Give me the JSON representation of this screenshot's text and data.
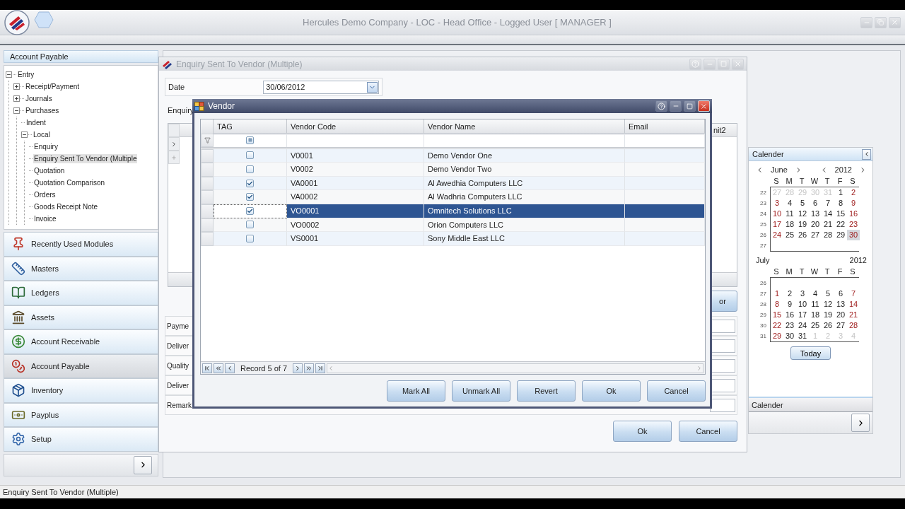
{
  "app": {
    "title": "Hercules  Demo Company - LOC - Head Office - Logged User [ MANAGER ]"
  },
  "sidebar": {
    "header": "Account Payable",
    "tree": [
      {
        "label": "Entry",
        "expanded": true,
        "selected": false,
        "children": [
          {
            "label": "Receipt/Payment",
            "expanded": false,
            "selected": false
          },
          {
            "label": "Journals",
            "expanded": false,
            "selected": false
          },
          {
            "label": "Purchases",
            "expanded": true,
            "selected": false,
            "children": [
              {
                "label": "Indent",
                "selected": false
              },
              {
                "label": "Local",
                "expanded": true,
                "selected": false,
                "children": [
                  {
                    "label": "Enquiry",
                    "selected": false
                  },
                  {
                    "label": "Enquiry Sent To Vendor (Multiple",
                    "selected": true
                  },
                  {
                    "label": "Quotation",
                    "selected": false
                  },
                  {
                    "label": "Quotation Comparison",
                    "selected": false
                  },
                  {
                    "label": "Orders",
                    "selected": false
                  },
                  {
                    "label": "Goods Receipt Note",
                    "selected": false
                  },
                  {
                    "label": "Invoice",
                    "selected": false
                  }
                ]
              }
            ]
          }
        ]
      }
    ],
    "modules": [
      {
        "label": "Recently Used Modules",
        "selected": false
      },
      {
        "label": "Masters",
        "selected": false
      },
      {
        "label": "Ledgers",
        "selected": false
      },
      {
        "label": "Assets",
        "selected": false
      },
      {
        "label": "Account Receivable",
        "selected": false
      },
      {
        "label": "Account Payable",
        "selected": true
      },
      {
        "label": "Inventory",
        "selected": false
      },
      {
        "label": "Payplus",
        "selected": false
      },
      {
        "label": "Setup",
        "selected": false
      }
    ]
  },
  "enquiry_window": {
    "title": "Enquiry Sent To Vendor (Multiple)",
    "date_label": "Date",
    "date_value": "30/06/2012",
    "enquiry_label": "Enquiry",
    "grid_column": "nit2",
    "side_button": "or",
    "labels": [
      "Payme",
      "Deliver",
      "Quality",
      "Deliver",
      "Remark"
    ],
    "buttons": [
      "Ok",
      "Cancel"
    ]
  },
  "vendor_window": {
    "title": "Vendor",
    "columns": [
      "TAG",
      "Vendor Code",
      "Vendor Name",
      "Email"
    ],
    "tag_filter": {
      "indeterminate": true
    },
    "rows": [
      {
        "checked": false,
        "code": "V0001",
        "name": "Demo Vendor One",
        "selected": false
      },
      {
        "checked": false,
        "code": "V0002",
        "name": "Demo Vendor Two",
        "selected": false
      },
      {
        "checked": true,
        "code": "VA0001",
        "name": "Al Awedhia Computers LLC",
        "selected": false
      },
      {
        "checked": true,
        "code": "VA0002",
        "name": "Al Wadhria Computers LLC",
        "selected": false
      },
      {
        "checked": true,
        "code": "VO0001",
        "name": "Omnitech Solutions LLC",
        "selected": true
      },
      {
        "checked": false,
        "code": "VO0002",
        "name": "Orion Computers LLC",
        "selected": false
      },
      {
        "checked": false,
        "code": "VS0001",
        "name": "Sony Middle East LLC",
        "selected": false
      }
    ],
    "record": "Record 5 of 7",
    "buttons": [
      "Mark All",
      "Unmark All",
      "Revert",
      "Ok",
      "Cancel"
    ]
  },
  "calendar": {
    "title": "Calender",
    "months": [
      {
        "month": "June",
        "year": "2012",
        "nav": true,
        "weekdays": [
          "S",
          "M",
          "T",
          "W",
          "T",
          "F",
          "S"
        ],
        "weeks": [
          {
            "week": "22",
            "days": [
              {
                "d": "27",
                "muted": true,
                "selected": false
              },
              {
                "d": "28",
                "muted": true,
                "selected": false
              },
              {
                "d": "29",
                "muted": true,
                "selected": false
              },
              {
                "d": "30",
                "muted": true,
                "selected": false
              },
              {
                "d": "31",
                "muted": true,
                "selected": false
              },
              {
                "d": "1",
                "muted": false,
                "selected": false
              },
              {
                "d": "2",
                "muted": false,
                "selected": false
              }
            ]
          },
          {
            "week": "23",
            "days": [
              {
                "d": "3",
                "muted": false,
                "selected": false
              },
              {
                "d": "4",
                "muted": false,
                "selected": false
              },
              {
                "d": "5",
                "muted": false,
                "selected": false
              },
              {
                "d": "6",
                "muted": false,
                "selected": false
              },
              {
                "d": "7",
                "muted": false,
                "selected": false
              },
              {
                "d": "8",
                "muted": false,
                "selected": false
              },
              {
                "d": "9",
                "muted": false,
                "selected": false
              }
            ]
          },
          {
            "week": "24",
            "days": [
              {
                "d": "10",
                "muted": false,
                "selected": false
              },
              {
                "d": "11",
                "muted": false,
                "selected": false
              },
              {
                "d": "12",
                "muted": false,
                "selected": false
              },
              {
                "d": "13",
                "muted": false,
                "selected": false
              },
              {
                "d": "14",
                "muted": false,
                "selected": false
              },
              {
                "d": "15",
                "muted": false,
                "selected": false
              },
              {
                "d": "16",
                "muted": false,
                "selected": false
              }
            ]
          },
          {
            "week": "25",
            "days": [
              {
                "d": "17",
                "muted": false,
                "selected": false
              },
              {
                "d": "18",
                "muted": false,
                "selected": false
              },
              {
                "d": "19",
                "muted": false,
                "selected": false
              },
              {
                "d": "20",
                "muted": false,
                "selected": false
              },
              {
                "d": "21",
                "muted": false,
                "selected": false
              },
              {
                "d": "22",
                "muted": false,
                "selected": false
              },
              {
                "d": "23",
                "muted": false,
                "selected": false
              }
            ]
          },
          {
            "week": "26",
            "days": [
              {
                "d": "24",
                "muted": false,
                "selected": false
              },
              {
                "d": "25",
                "muted": false,
                "selected": false
              },
              {
                "d": "26",
                "muted": false,
                "selected": false
              },
              {
                "d": "27",
                "muted": false,
                "selected": false
              },
              {
                "d": "28",
                "muted": false,
                "selected": false
              },
              {
                "d": "29",
                "muted": false,
                "selected": false
              },
              {
                "d": "30",
                "muted": false,
                "selected": true
              }
            ]
          },
          {
            "week": "27"
          }
        ]
      },
      {
        "month": "July",
        "year": "2012",
        "nav": false,
        "weekdays": [
          "S",
          "M",
          "T",
          "W",
          "T",
          "F",
          "S"
        ],
        "weeks": [
          {
            "week": "26"
          },
          {
            "week": "27",
            "days": [
              {
                "d": "1",
                "muted": false,
                "selected": false
              },
              {
                "d": "2",
                "muted": false,
                "selected": false
              },
              {
                "d": "3",
                "muted": false,
                "selected": false
              },
              {
                "d": "4",
                "muted": false,
                "selected": false
              },
              {
                "d": "5",
                "muted": false,
                "selected": false
              },
              {
                "d": "6",
                "muted": false,
                "selected": false
              },
              {
                "d": "7",
                "muted": false,
                "selected": false
              }
            ]
          },
          {
            "week": "28",
            "days": [
              {
                "d": "8",
                "muted": false,
                "selected": false
              },
              {
                "d": "9",
                "muted": false,
                "selected": false
              },
              {
                "d": "10",
                "muted": false,
                "selected": false
              },
              {
                "d": "11",
                "muted": false,
                "selected": false
              },
              {
                "d": "12",
                "muted": false,
                "selected": false
              },
              {
                "d": "13",
                "muted": false,
                "selected": false
              },
              {
                "d": "14",
                "muted": false,
                "selected": false
              }
            ]
          },
          {
            "week": "29",
            "days": [
              {
                "d": "15",
                "muted": false,
                "selected": false
              },
              {
                "d": "16",
                "muted": false,
                "selected": false
              },
              {
                "d": "17",
                "muted": false,
                "selected": false
              },
              {
                "d": "18",
                "muted": false,
                "selected": false
              },
              {
                "d": "19",
                "muted": false,
                "selected": false
              },
              {
                "d": "20",
                "muted": false,
                "selected": false
              },
              {
                "d": "21",
                "muted": false,
                "selected": false
              }
            ]
          },
          {
            "week": "30",
            "days": [
              {
                "d": "22",
                "muted": false,
                "selected": false
              },
              {
                "d": "23",
                "muted": false,
                "selected": false
              },
              {
                "d": "24",
                "muted": false,
                "selected": false
              },
              {
                "d": "25",
                "muted": false,
                "selected": false
              },
              {
                "d": "26",
                "muted": false,
                "selected": false
              },
              {
                "d": "27",
                "muted": false,
                "selected": false
              },
              {
                "d": "28",
                "muted": false,
                "selected": false
              }
            ]
          },
          {
            "week": "31",
            "days": [
              {
                "d": "29",
                "muted": false,
                "selected": false
              },
              {
                "d": "30",
                "muted": false,
                "selected": false
              },
              {
                "d": "31",
                "muted": false,
                "selected": false
              },
              {
                "d": "1",
                "muted": true,
                "selected": false
              },
              {
                "d": "2",
                "muted": true,
                "selected": false
              },
              {
                "d": "3",
                "muted": true,
                "selected": false
              },
              {
                "d": "4",
                "muted": true,
                "selected": false
              }
            ]
          }
        ]
      }
    ],
    "today_button": "Today",
    "lower_title": "Calender"
  },
  "status_bar": {
    "text": "Enquiry Sent To Vendor (Multiple)"
  }
}
